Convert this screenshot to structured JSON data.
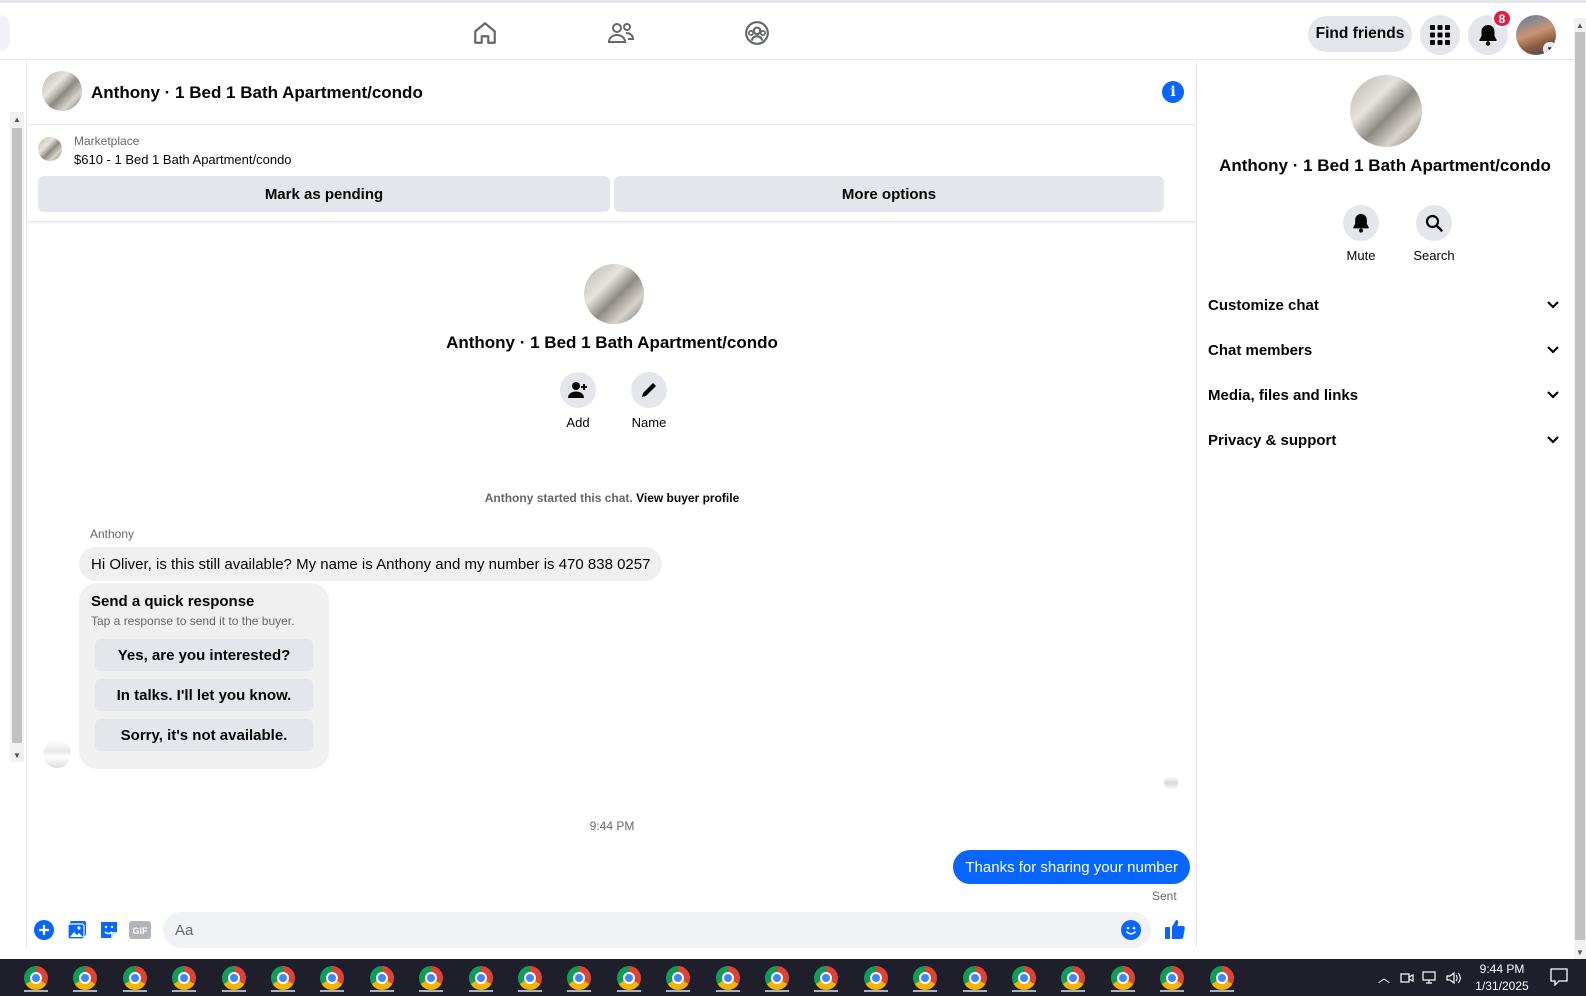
{
  "topbar": {
    "nav_icons": [
      "home-icon",
      "friends-icon",
      "groups-icon"
    ],
    "find_friends_label": "Find friends",
    "notifications_count": "8",
    "menu_icon": "grid-menu-icon",
    "bell_icon": "bell-icon"
  },
  "chat": {
    "title": "Anthony · 1 Bed 1 Bath Apartment/condo",
    "marketplace_label": "Marketplace",
    "listing": "$610 - 1 Bed 1 Bath Apartment/condo",
    "mark_pending_label": "Mark as pending",
    "more_options_label": "More options",
    "intro_title": "Anthony · 1 Bed 1 Bath Apartment/condo",
    "add_label": "Add",
    "name_label": "Name",
    "started_text": "Anthony started this chat.",
    "view_profile_label": "View buyer profile",
    "sender": "Anthony",
    "incoming_message": "Hi Oliver, is this still available? My name is Anthony and my number is 470 838 0257",
    "quick_title": "Send a quick response",
    "quick_subtitle": "Tap a response to send it to the buyer.",
    "quick_responses": [
      "Yes, are you interested?",
      "In talks. I'll let you know.",
      "Sorry, it's not available."
    ],
    "timestamp": "9:44 PM",
    "outgoing_message": "Thanks for sharing your number",
    "status": "Sent",
    "composer_placeholder": "Aa"
  },
  "right_panel": {
    "title": "Anthony · 1 Bed 1 Bath Apartment/condo",
    "mute_label": "Mute",
    "search_label": "Search",
    "sections": [
      "Customize chat",
      "Chat members",
      "Media, files and links",
      "Privacy & support"
    ]
  },
  "taskbar": {
    "time": "9:44 PM",
    "date": "1/31/2025",
    "app_count": 25
  },
  "colors": {
    "accent": "#0866ff",
    "badge": "#e41e3f",
    "bubble_in": "#f0f0f0",
    "button_bg": "#e4e6eb"
  }
}
